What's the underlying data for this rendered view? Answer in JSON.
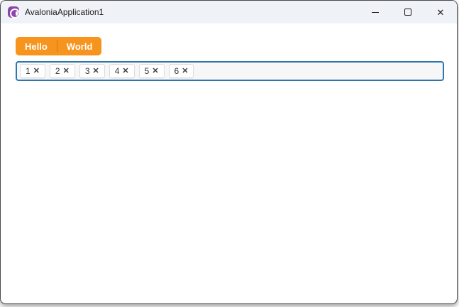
{
  "window": {
    "title": "AvaloniaApplication1"
  },
  "icons": {
    "app": "avalonia-logo",
    "minimize": "–",
    "maximize": "□",
    "close": "✕",
    "chip_remove": "✕"
  },
  "tabs": [
    {
      "label": "Hello"
    },
    {
      "label": "World"
    }
  ],
  "chipbox": {
    "chips": [
      {
        "label": "1"
      },
      {
        "label": "2"
      },
      {
        "label": "3"
      },
      {
        "label": "4"
      },
      {
        "label": "5"
      },
      {
        "label": "6"
      }
    ]
  },
  "colors": {
    "tab_orange": "#f7941d",
    "focus_border_blue": "#2e77ae",
    "logo_purple": "#8b44ac",
    "titlebar_bg": "#eff3f7"
  }
}
